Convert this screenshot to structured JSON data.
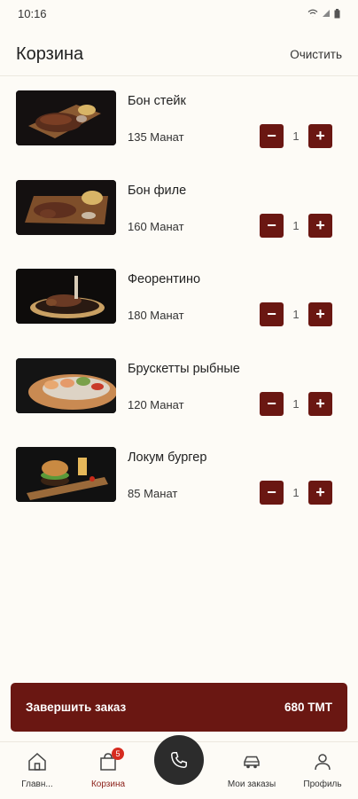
{
  "status": {
    "time": "10:16"
  },
  "header": {
    "title": "Корзина",
    "clear_label": "Очистить"
  },
  "items": [
    {
      "name": "Бон стейк",
      "price": "135 Манат",
      "qty": "1"
    },
    {
      "name": "Бон филе",
      "price": "160 Манат",
      "qty": "1"
    },
    {
      "name": "Феорентино",
      "price": "180 Манат",
      "qty": "1"
    },
    {
      "name": "Брускетты рыбные",
      "price": "120 Манат",
      "qty": "1"
    },
    {
      "name": "Локум бургер",
      "price": "85 Манат",
      "qty": "1"
    }
  ],
  "controls": {
    "minus": "−",
    "plus": "+"
  },
  "checkout": {
    "label": "Завершить заказ",
    "total": "680 ТМТ"
  },
  "tabbar": {
    "home": "Главн...",
    "cart": "Корзина",
    "cart_badge": "5",
    "orders": "Мои заказы",
    "profile": "Профиль"
  },
  "colors": {
    "accent": "#6a1712",
    "badge": "#d62b1f",
    "background": "#fdfbf6"
  }
}
